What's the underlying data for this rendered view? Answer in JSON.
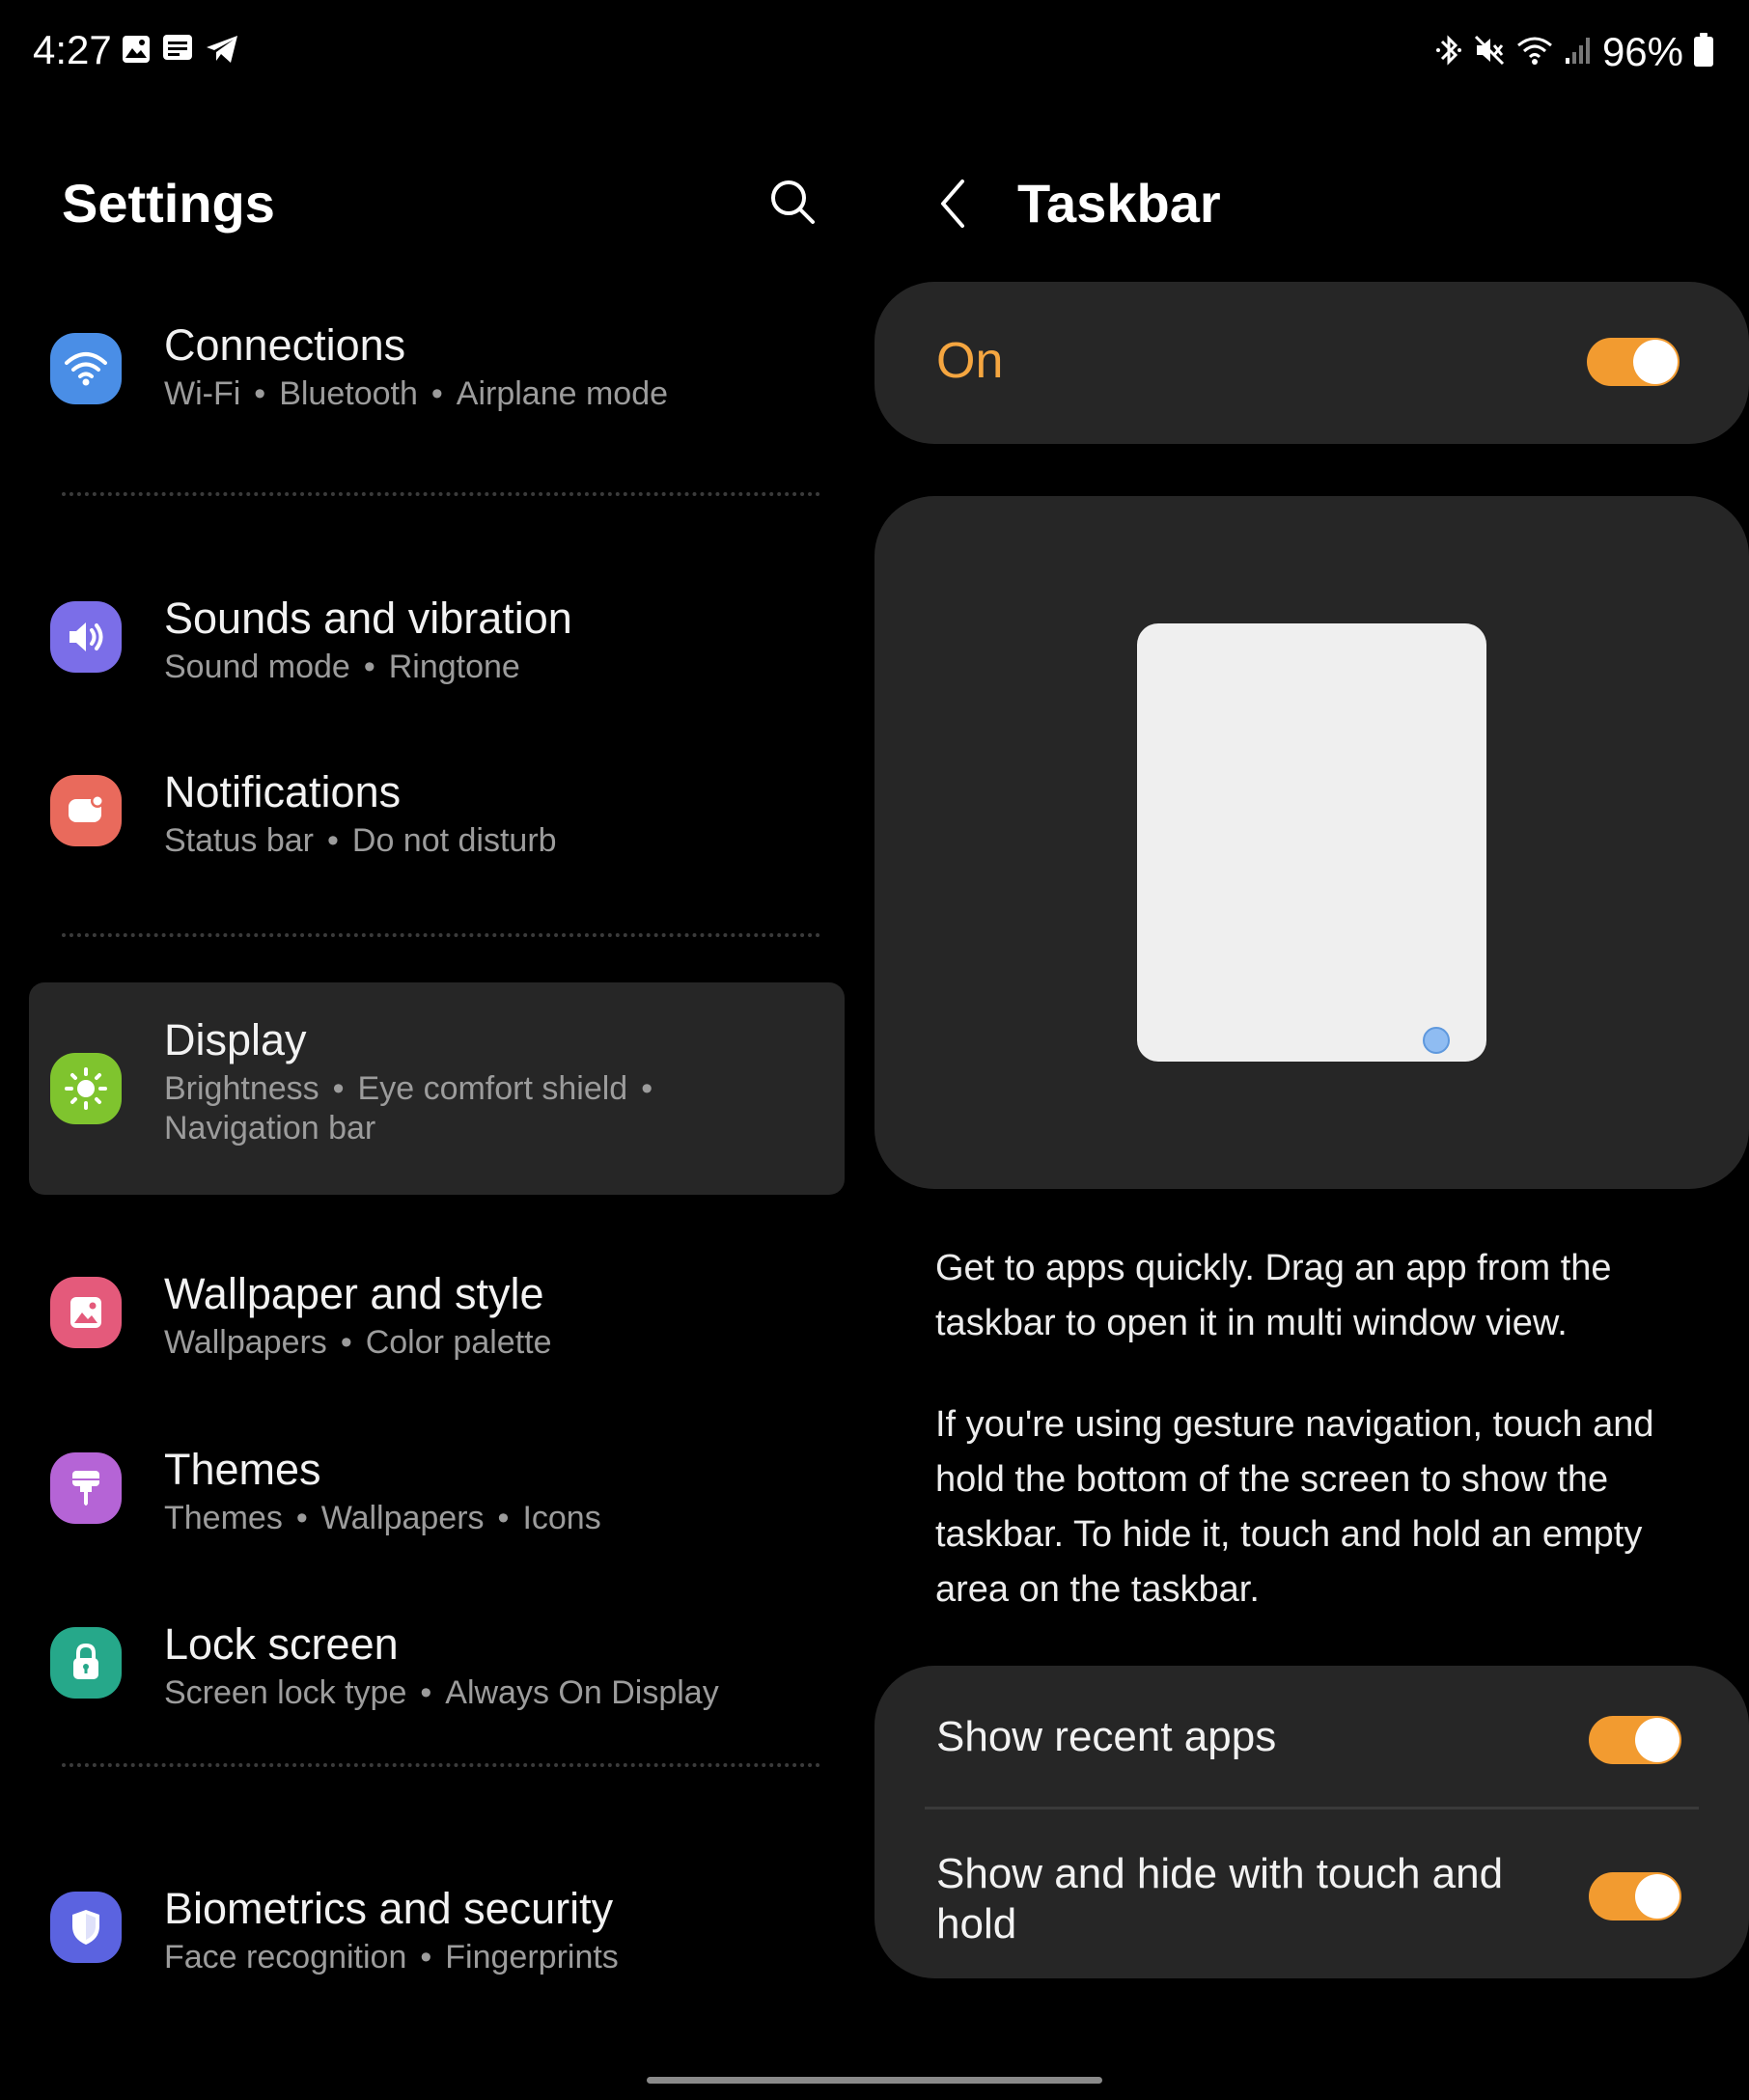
{
  "status_bar": {
    "time": "4:27",
    "left_icons": [
      "gallery-icon",
      "message-icon",
      "telegram-icon"
    ],
    "right_icons": [
      "bluetooth-icon",
      "mute-icon",
      "wifi-icon",
      "signal-icon",
      "battery-icon"
    ],
    "battery_text": "96%"
  },
  "left_pane": {
    "title": "Settings",
    "search_icon": "search-icon",
    "items": [
      {
        "title": "Connections",
        "subtitle": [
          "Wi-Fi",
          "Bluetooth",
          "Airplane mode"
        ],
        "icon": "wifi-icon",
        "color": "#4a8ee6",
        "selected": false
      },
      {
        "title": "Sounds and vibration",
        "subtitle": [
          "Sound mode",
          "Ringtone"
        ],
        "icon": "volume-icon",
        "color": "#7b6ee8",
        "selected": false
      },
      {
        "title": "Notifications",
        "subtitle": [
          "Status bar",
          "Do not disturb"
        ],
        "icon": "notification-icon",
        "color": "#e96a5c",
        "selected": false
      },
      {
        "title": "Display",
        "subtitle": [
          "Brightness",
          "Eye comfort shield",
          "Navigation bar"
        ],
        "icon": "sun-icon",
        "color": "#7fc42e",
        "selected": true
      },
      {
        "title": "Wallpaper and style",
        "subtitle": [
          "Wallpapers",
          "Color palette"
        ],
        "icon": "wallpaper-icon",
        "color": "#e45a7b",
        "selected": false
      },
      {
        "title": "Themes",
        "subtitle": [
          "Themes",
          "Wallpapers",
          "Icons"
        ],
        "icon": "brush-icon",
        "color": "#b564d6",
        "selected": false
      },
      {
        "title": "Lock screen",
        "subtitle": [
          "Screen lock type",
          "Always On Display"
        ],
        "icon": "lock-icon",
        "color": "#26a88a",
        "selected": false
      },
      {
        "title": "Biometrics and security",
        "subtitle": [
          "Face recognition",
          "Fingerprints"
        ],
        "icon": "shield-icon",
        "color": "#5b63e0",
        "selected": false
      }
    ]
  },
  "right_pane": {
    "title": "Taskbar",
    "back_icon": "back-arrow-icon",
    "master_switch": {
      "label": "On",
      "on": true
    },
    "description": [
      "Get to apps quickly. Drag an app from the taskbar to open it in multi window view.",
      "If you're using gesture navigation, touch and hold the bottom of the screen to show the taskbar. To hide it, touch and hold an empty area on the taskbar."
    ],
    "options": [
      {
        "label": "Show recent apps",
        "on": true
      },
      {
        "label": "Show and hide with touch and hold",
        "on": true
      }
    ]
  },
  "colors": {
    "accent": "#f29b30",
    "background": "#000000",
    "card": "#262626"
  }
}
